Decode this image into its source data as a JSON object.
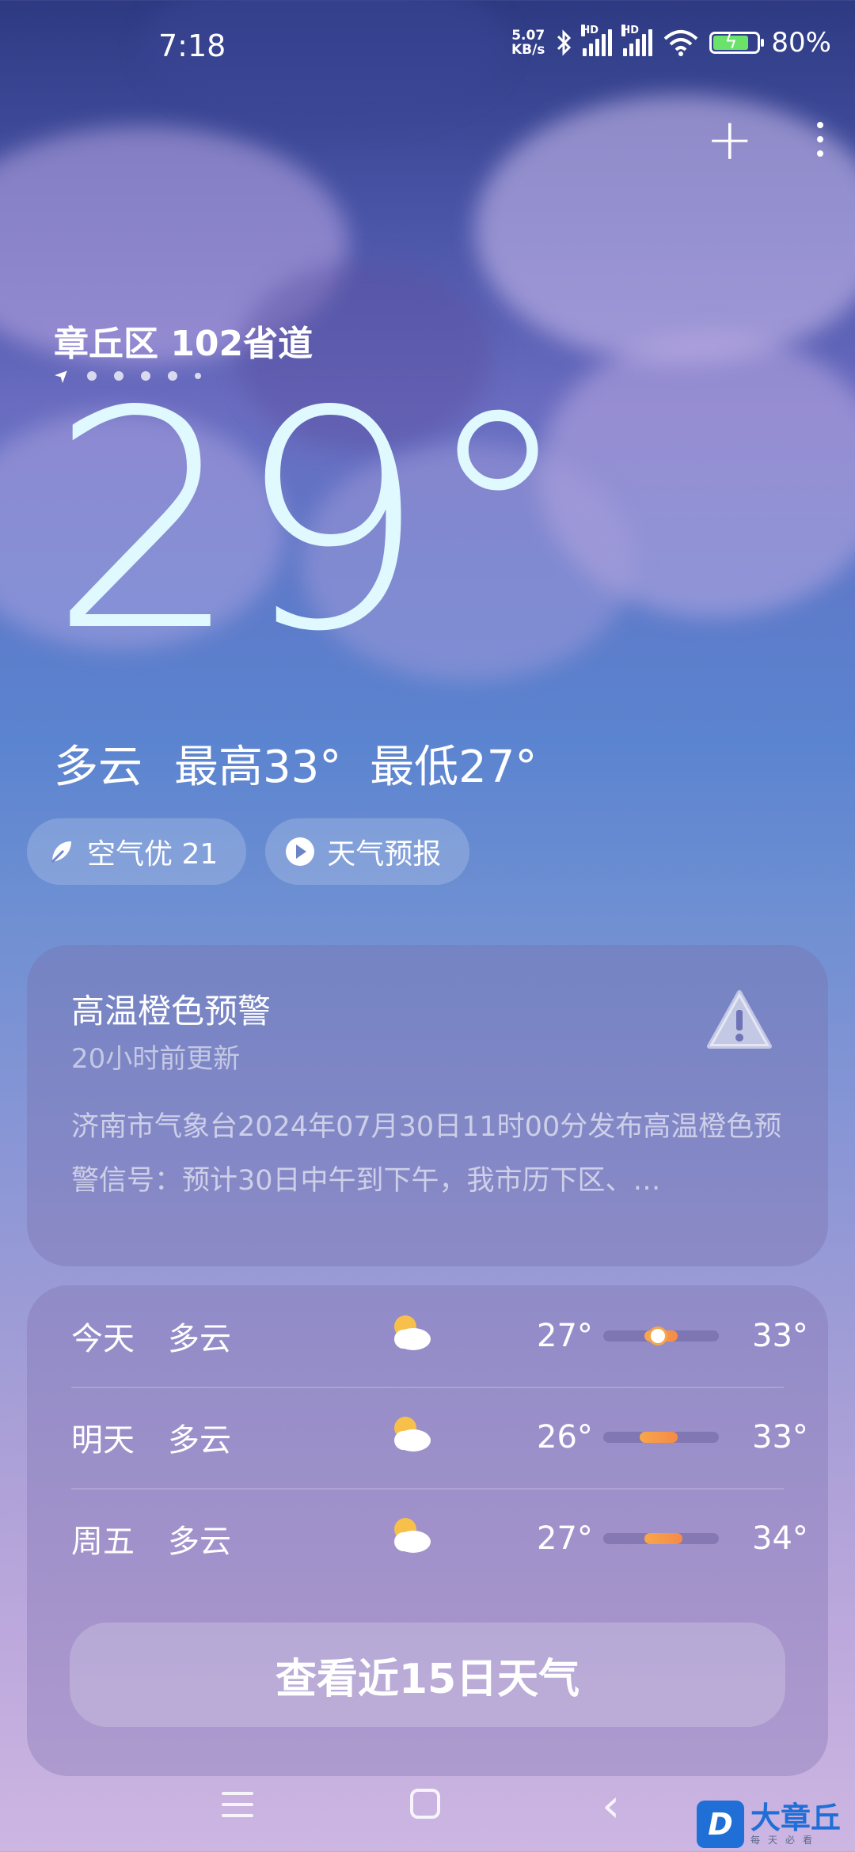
{
  "status_bar": {
    "time": "7:18",
    "net_speed_value": "5.07",
    "net_speed_unit": "KB/s",
    "signal1_label": "HD",
    "signal2_label": "HD",
    "battery_percent": "80%",
    "battery_level": 0.8
  },
  "location": "章丘区 102省道",
  "current": {
    "temperature": "29°",
    "condition": "多云",
    "high": "最高33°",
    "low": "最低27°"
  },
  "chips": {
    "air_quality": "空气优 21",
    "forecast_video": "天气预报"
  },
  "warning": {
    "title": "高温橙色预警",
    "updated": "20小时前更新",
    "body": "济南市气象台2024年07月30日11时00分发布高温橙色预警信号：预计30日中午到下午，我市历下区、…"
  },
  "forecast": [
    {
      "day": "今天",
      "condition": "多云",
      "low": "27°",
      "high": "33°",
      "icon": "partly-cloudy-icon"
    },
    {
      "day": "明天",
      "condition": "多云",
      "low": "26°",
      "high": "33°",
      "icon": "partly-cloudy-icon"
    },
    {
      "day": "周五",
      "condition": "多云",
      "low": "27°",
      "high": "34°",
      "icon": "partly-cloudy-icon"
    }
  ],
  "forecast_button": "查看近15日天气",
  "watermark": {
    "logo": "D",
    "name": "大章丘",
    "sub": "每天必看"
  },
  "colors": {
    "temp_text": "#dff9ff",
    "bar_warm": "#f58a48",
    "watermark_blue": "#1f6fd6"
  }
}
